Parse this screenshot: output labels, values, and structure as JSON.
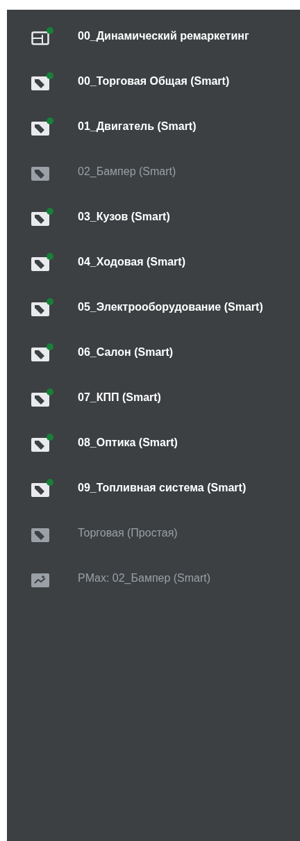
{
  "campaigns": [
    {
      "name": "00_Динамический ремаркетинг",
      "kind": "display",
      "enabled": true
    },
    {
      "name": "00_Торговая Общая (Smart)",
      "kind": "shopping",
      "enabled": true
    },
    {
      "name": "01_Двигатель (Smart)",
      "kind": "shopping",
      "enabled": true
    },
    {
      "name": "02_Бампер (Smart)",
      "kind": "shopping",
      "enabled": false
    },
    {
      "name": "03_Кузов (Smart)",
      "kind": "shopping",
      "enabled": true
    },
    {
      "name": "04_Ходовая (Smart)",
      "kind": "shopping",
      "enabled": true
    },
    {
      "name": "05_Электрооборудование (Smart)",
      "kind": "shopping",
      "enabled": true
    },
    {
      "name": "06_Салон (Smart)",
      "kind": "shopping",
      "enabled": true
    },
    {
      "name": "07_КПП (Smart)",
      "kind": "shopping",
      "enabled": true
    },
    {
      "name": "08_Оптика (Smart)",
      "kind": "shopping",
      "enabled": true
    },
    {
      "name": "09_Топливная система (Smart)",
      "kind": "shopping",
      "enabled": true
    },
    {
      "name": "Торговая (Простая)",
      "kind": "shopping",
      "enabled": false
    },
    {
      "name": "PMax: 02_Бампер (Smart)",
      "kind": "pmax",
      "enabled": false
    }
  ]
}
